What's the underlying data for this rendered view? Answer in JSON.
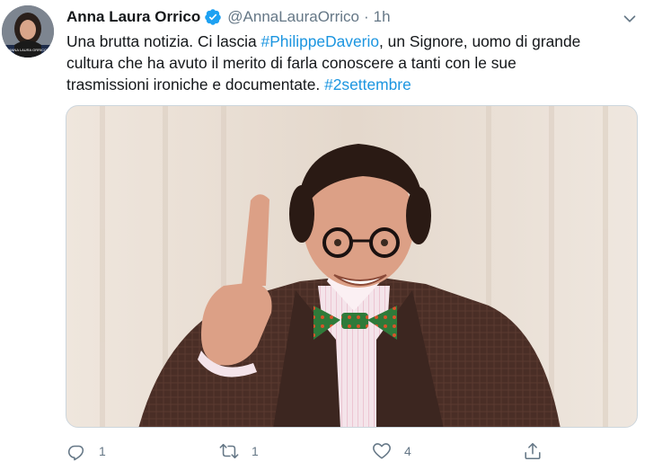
{
  "tweet": {
    "author": {
      "display_name": "Anna Laura Orrico",
      "handle": "@AnnaLauraOrrico",
      "verified": true,
      "avatar_caption": "ANNA LAURA ORRICO"
    },
    "separator": "·",
    "time": "1h",
    "text": {
      "line1_a": "Una brutta notizia. Ci lascia ",
      "hashtag1": "#PhilippeDaverio",
      "line1_b": ", un Signore, uomo di grande",
      "line2": "cultura che ha avuto il merito di farla conoscere a tanti con le sue",
      "line3_a": "trasmissioni ironiche e documentate. ",
      "hashtag2": "#2settembre"
    },
    "media": {
      "description_icon": "photo-man-bowtie-glasses"
    },
    "actions": {
      "reply_count": "1",
      "retweet_count": "1",
      "like_count": "4"
    }
  },
  "colors": {
    "link": "#1b95e0",
    "text": "#14171a",
    "secondary": "#657786",
    "verified": "#1da1f2"
  },
  "icons": [
    "verified-badge-icon",
    "chevron-down-icon",
    "reply-icon",
    "retweet-icon",
    "like-icon",
    "share-icon"
  ]
}
